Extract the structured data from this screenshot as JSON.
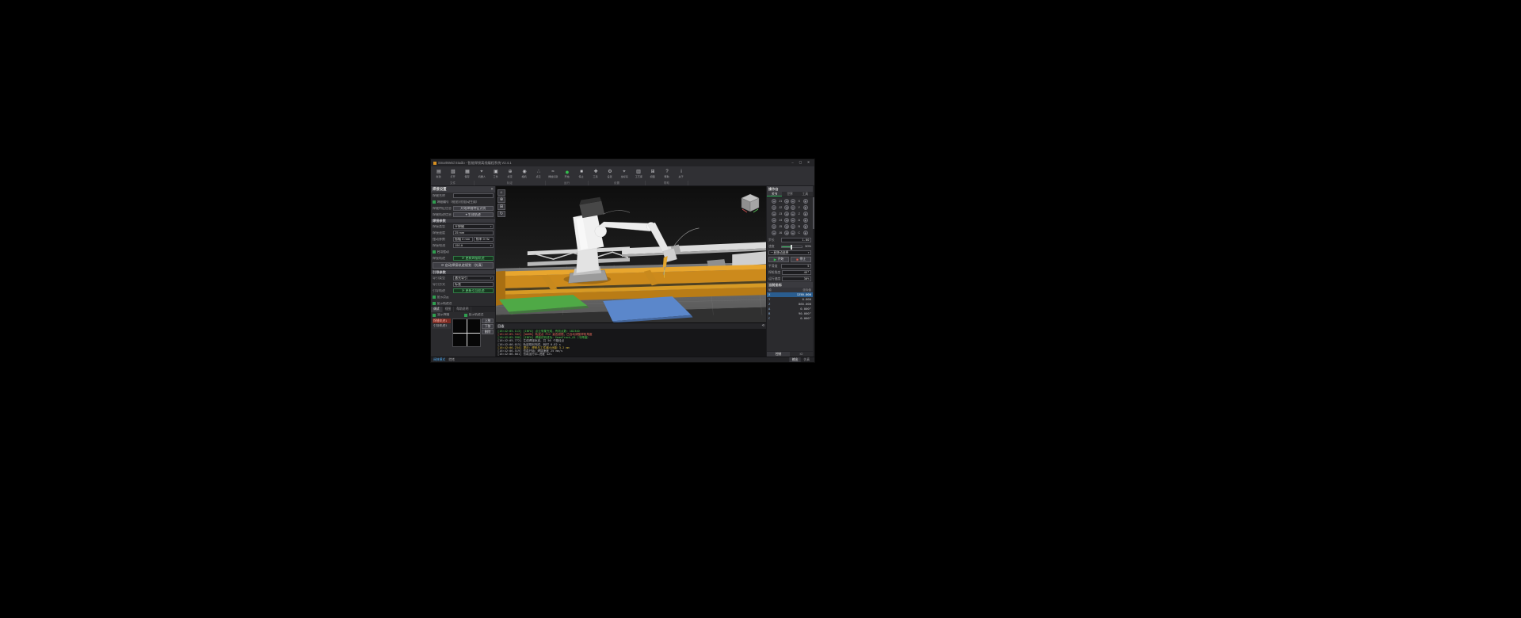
{
  "window": {
    "title": "SmartWeld Studio - 智能焊接离线编程系统 V2.4.1",
    "minimize": "–",
    "maximize": "▢",
    "close": "✕"
  },
  "ribbon": {
    "buttons": [
      {
        "icon": "▤",
        "label": "新建"
      },
      {
        "icon": "▧",
        "label": "打开"
      },
      {
        "icon": "▦",
        "label": "保存"
      },
      {
        "icon": "⌖",
        "label": "机器人"
      },
      {
        "icon": "▣",
        "label": "工件"
      },
      {
        "icon": "⊕",
        "label": "标定"
      },
      {
        "icon": "◉",
        "label": "相机"
      },
      {
        "icon": "∴",
        "label": "点云"
      },
      {
        "icon": "≈",
        "label": "焊缝识别"
      },
      {
        "icon": "●",
        "label": "开始",
        "accent": "true"
      },
      {
        "icon": "■",
        "label": "停止"
      },
      {
        "icon": "✚",
        "label": "工具"
      },
      {
        "icon": "⚙",
        "label": "设置"
      },
      {
        "icon": "⌖",
        "label": "坐标系"
      },
      {
        "icon": "▥",
        "label": "工艺库"
      },
      {
        "icon": "⊞",
        "label": "视图"
      },
      {
        "icon": "?",
        "label": "帮助"
      },
      {
        "icon": "i",
        "label": "关于"
      }
    ],
    "groups": [
      {
        "label": "文件",
        "style": "width:54px"
      },
      {
        "label": "标定",
        "style": "width:90px"
      },
      {
        "label": "运行",
        "style": "width:54px"
      },
      {
        "label": "设置",
        "style": "width:72px"
      },
      {
        "label": "帮助",
        "style": "width:54px"
      }
    ]
  },
  "left": {
    "title": "焊接设置",
    "close_icon": "✕",
    "name_label": "焊缝名称",
    "name_value": "",
    "auto_check_label": "焊缝编号（视觉识别自动生成）",
    "feature_label": "焊缝特征信息",
    "feature_button": "开始焊缝特征识别",
    "track_label": "焊缝轨迹信息",
    "track_button": "⌖ 生成轨迹",
    "weld_title": "焊接参数",
    "type_label": "焊接类型",
    "type_value": "平焊缝",
    "speed_label": "焊接速度",
    "speed_value": "25 mm",
    "weave_label": "摆动参数",
    "weave_amp": "振幅 0 mm",
    "weave_freq": "频率 0 Hz",
    "current_label": "焊接电流",
    "current_value": "150 A",
    "weave_check_label": "启用摆动",
    "track2_label": "焊接轨迹",
    "update_weld_button": "⟳ 更新焊接轨迹",
    "plan_button": "⟳ 启动焊接轨迹规划（仿真）",
    "guide_title": "引导参数",
    "guide_type_label": "导引类型",
    "guide_type_value": "激光导引",
    "guide_mode_label": "导引方式",
    "guide_mode_value": "标准",
    "guide_track_label": "引导轨迹",
    "update_guide_button": "⟳ 更新引导轨迹",
    "show_cloud_label": "显示点云",
    "show_points_label": "显示轨迹点"
  },
  "seam": {
    "tabs": [
      {
        "label": "调试",
        "active": "true"
      },
      {
        "label": "视图"
      },
      {
        "label": "帮助说明"
      }
    ],
    "check1": "显示焊缝",
    "check2": "显示轨迹点",
    "items": [
      {
        "label": "焊缝轨迹1",
        "active": "true"
      },
      {
        "label": "引导轨迹1"
      }
    ],
    "buttons": [
      {
        "label": "上移"
      },
      {
        "label": "下移"
      },
      {
        "label": "删除"
      }
    ]
  },
  "viewport": {
    "tools": [
      {
        "icon": "⌂"
      },
      {
        "icon": "⊕"
      },
      {
        "icon": "⊞"
      },
      {
        "icon": "↻"
      }
    ]
  },
  "log": {
    "title": "日志",
    "clear_icon": "⟲",
    "lines": [
      {
        "color": "green",
        "text": "[16:42:05.113] [INFO] 点云采集完成，有效点数：182340"
      },
      {
        "color": "red",
        "text": "[16:42:05.342] [WARN] 轨迹点 P12 姿态超限，已自动调整焊枪角度"
      },
      {
        "color": "green",
        "text": "[16:42:05.598] [INFO] 焊缝识别成功：SeamTrack_01（平焊缝）"
      },
      {
        "color": "white",
        "text": "[16:42:05.772] 生成焊接轨迹，共 56 个路径点"
      },
      {
        "color": "white",
        "text": "[16:42:06.015] 轨迹规划完成，耗时 0.82 s"
      },
      {
        "color": "yellow",
        "text": "[16:42:06.234] 提示：焊枪与工件最小间距 3.2 mm"
      },
      {
        "color": "white",
        "text": "[16:42:06.519] 仿真开始：焊接速度 25 mm/s"
      },
      {
        "color": "white",
        "text": "[16:42:06.801] 仿真运行中…进度 42%"
      }
    ]
  },
  "right": {
    "title": "操作台",
    "tabs": [
      {
        "label": "关节",
        "active": "true"
      },
      {
        "label": "世界"
      },
      {
        "label": "工具"
      }
    ],
    "jog_minus": "−",
    "jog_plus": "+",
    "jog_rows": [
      {
        "j": "J1",
        "c": "X"
      },
      {
        "j": "J2",
        "c": "Y"
      },
      {
        "j": "J3",
        "c": "Z"
      },
      {
        "j": "J4",
        "c": "A"
      },
      {
        "j": "J5",
        "c": "B"
      },
      {
        "j": "J6",
        "c": "C"
      }
    ],
    "step_label": "步长",
    "step_value": "1.00",
    "speed_label": "速度",
    "speed_value": "50%",
    "speed_fill_style": "width:50%",
    "mode_value": "一直移动选择",
    "start_icon": "▶",
    "start_label": "开始",
    "stop_icon": "■",
    "stop_label": "停止",
    "params": [
      {
        "label": "平滑度",
        "value": "5"
      },
      {
        "label": "焊枪角度",
        "value": "45°"
      },
      {
        "label": "运行速度",
        "value": "30%"
      }
    ],
    "coords_title": "当前坐标",
    "coords_h1": "轴",
    "coords_h2": "坐标值",
    "coords": [
      {
        "axis": "X",
        "value": "1250.000",
        "active": "true"
      },
      {
        "axis": "Y",
        "value": "0.000"
      },
      {
        "axis": "Z",
        "value": "860.000"
      },
      {
        "axis": "A",
        "value": "0.000°"
      },
      {
        "axis": "B",
        "value": "90.000°"
      },
      {
        "axis": "C",
        "value": "0.000°"
      }
    ],
    "bottom_tabs": [
      {
        "label": "控制",
        "active": "true"
      },
      {
        "label": "IO"
      }
    ]
  },
  "status": {
    "mode": "阀体模式",
    "ready": "就绪",
    "tabs": [
      {
        "label": "输出",
        "active": "true"
      },
      {
        "label": "仿真"
      }
    ]
  }
}
